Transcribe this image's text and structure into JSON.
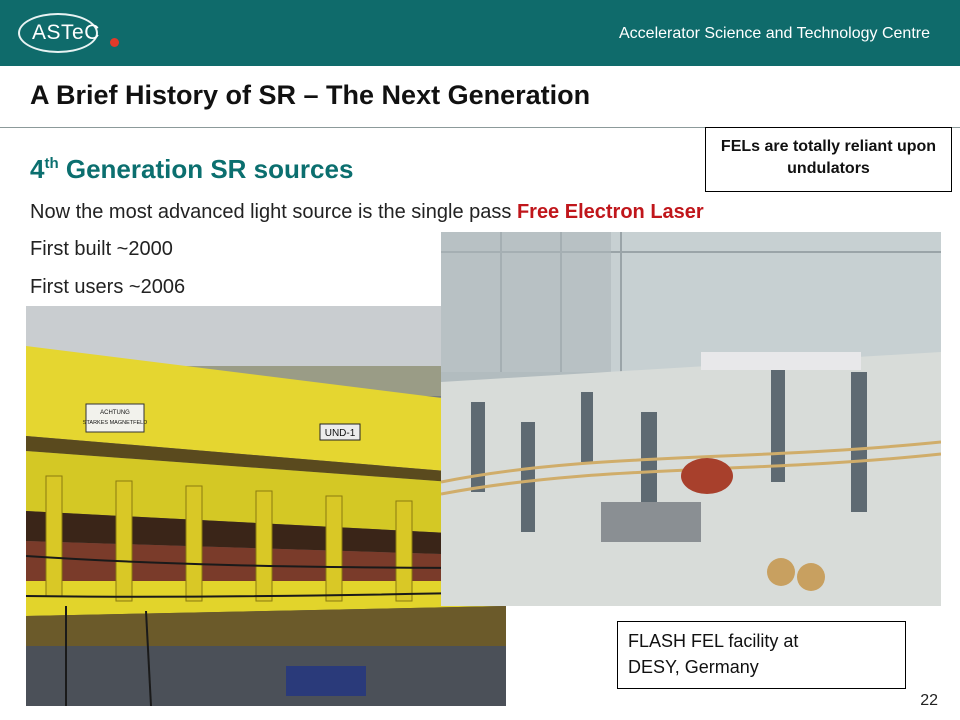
{
  "header": {
    "logo_text": "ASTeC",
    "organisation": "Accelerator Science and Technology Centre"
  },
  "slide": {
    "title": "A Brief History of SR – The Next Generation",
    "subheading_number": "4",
    "subheading_suffix": "th",
    "subheading_rest": " Generation SR sources",
    "line1_prefix": "Now the most advanced light source is the single pass ",
    "line1_accent": "Free Electron Laser",
    "line2": "First built ~2000",
    "line3": "First users ~2006",
    "note": "FELs are totally reliant upon undulators",
    "photo1_sign": "ACHTUNG STARKES MAGNETFELD",
    "photo1_label": "UND-1",
    "caption_line1": "FLASH FEL facility at",
    "caption_line2": "DESY, Germany",
    "page_number": "22"
  },
  "colors": {
    "banner": "#0f6b6b",
    "subheading": "#0b6f6f",
    "accent": "#c0161b"
  }
}
